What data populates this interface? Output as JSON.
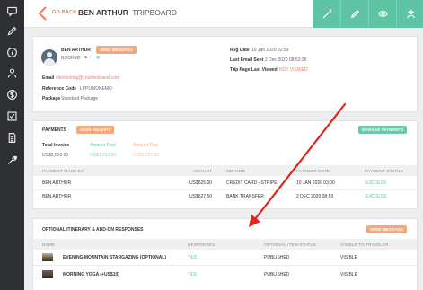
{
  "header": {
    "back_label": "GO BACK",
    "name": "BEN ARTHUR",
    "subtitle": "TRIPBOARD"
  },
  "profile": {
    "name": "BEN ARTHUR",
    "status": "BOOKED",
    "send_message": "SEND MESSAGE",
    "reg_date_label": "Reg Date",
    "reg_date_value": "10 Jan 2020 02:59",
    "last_email_label": "Last Email Sent",
    "last_email_value": "2 Dec 2020 08:53:36",
    "trip_page_label": "Trip Page Last Viewed",
    "trip_page_value": "NOT VIEWED",
    "email_label": "Email",
    "email_value": "ellentesting@yourbestravel.com",
    "reference_label": "Reference Code",
    "reference_value": "LPPUMOKEMO",
    "package_label": "Package",
    "package_value": "Standard Package"
  },
  "payments": {
    "title": "PAYMENTS",
    "send_receipt": "SEND RECEIPT",
    "manage": "MANAGE PAYMENTS",
    "total_invoice_label": "Total Invoice",
    "total_invoice_value": "US$2,510.00",
    "amount_paid_label": "Amount Paid",
    "amount_paid_value": "US$1,252.50",
    "amount_due_label": "Amount Due",
    "amount_due_value": "US$1,257.50",
    "columns": [
      "PAYMENT MADE BY",
      "AMOUNT",
      "METHOD",
      "PAYMENT DATE",
      "PAYMENT STATUS"
    ],
    "rows": [
      {
        "by": "BEN ARTHUR",
        "amount": "US$625.00",
        "method": "CREDIT CARD - STRIPE",
        "date": "10 JAN 2020 03:00",
        "status": "SUCCESS"
      },
      {
        "by": "BEN ARTHUR",
        "amount": "US$627.50",
        "method": "BANK TRANSFER",
        "date": "2 DEC 2020 08:53",
        "status": "SUCCESS"
      }
    ]
  },
  "optional": {
    "title": "OPTIONAL ITINERARY & ADD-ON RESPONSES",
    "send_message": "SEND MESSAGE",
    "columns": [
      "NAME",
      "RESPONSES",
      "OPTIONAL ITEM STATUS",
      "VISIBLE TO TRAVELER"
    ],
    "rows": [
      {
        "name": "EVENING MOUNTAIN STARGAZING (OPTIONAL)",
        "response": "YES",
        "status": "PUBLISHED",
        "visible": "VISIBLE"
      },
      {
        "name": "MORNING YOGA (+US$10)",
        "response": "YES",
        "status": "PUBLISHED",
        "visible": "VISIBLE"
      }
    ]
  },
  "colors": {
    "accent_orange": "#f07a5f",
    "accent_green": "#5fc4a4",
    "sidebar": "#2e3034",
    "arrow_red": "#e0261b"
  }
}
